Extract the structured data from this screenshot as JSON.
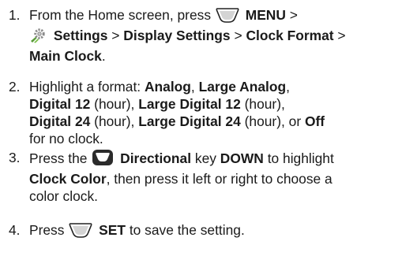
{
  "steps": [
    {
      "number": "1.",
      "text_a": "From the Home screen, press",
      "key_menu": "MENU",
      "sep": ">",
      "settings": "Settings",
      "display_settings": "Display Settings",
      "clock_format": "Clock Format",
      "main_clock": "Main Clock",
      "end": "."
    },
    {
      "number": "2.",
      "text_a": "Highlight a format:",
      "analog": "Analog",
      "comma": ",",
      "large_analog": "Large Analog",
      "digital12": "Digital 12",
      "hour": "(hour),",
      "large_digital12": "Large Digital 12",
      "digital24": "Digital 24",
      "large_digital24": "Large Digital 24",
      "hour_or": "(hour), or",
      "off": "Off",
      "for_no_clock": "for no clock."
    },
    {
      "number": "3.",
      "text_a": "Press the",
      "directional": "Directional",
      "key": "key",
      "down": "DOWN",
      "to_highlight": "to highlight",
      "clock_color": "Clock Color",
      "then": ", then press it left or right to choose a",
      "color_clock": "color clock."
    },
    {
      "number": "4.",
      "text_a": "Press",
      "set": "SET",
      "to_save": "to save the setting."
    }
  ],
  "icons": {
    "softkey": "left-softkey-icon",
    "settings": "settings-gear-icon",
    "directional": "directional-key-icon"
  }
}
